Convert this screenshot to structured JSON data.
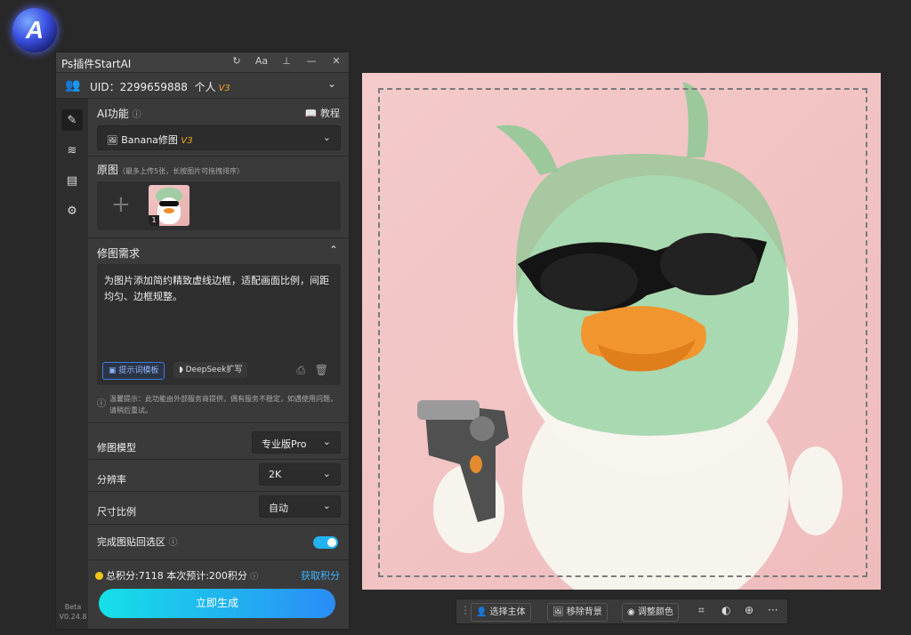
{
  "logo": {
    "letter": "A"
  },
  "panel": {
    "title": "Ps插件StartAI",
    "title_icons": [
      "refresh-icon",
      "font-size-icon",
      "pin-icon",
      "minimize-icon",
      "close-icon"
    ],
    "title_icon_glyphs": [
      "↻",
      "Aa",
      "⊥",
      "—",
      "✕"
    ],
    "uid_label": "UID：2299659888",
    "plan": "个人",
    "plan_version": "V3",
    "ai_function_label": "AI功能",
    "tutorial_label": "教程",
    "function_selected": "Banana修图",
    "function_version": "V3",
    "original_label": "原图",
    "original_note": "（最多上传5张，长按图片可拖拽排序）",
    "thumb_index": "1",
    "requirement_label": "修图需求",
    "requirement_text": "为图片添加简约精致虚线边框，适配画面比例，间距均匀、边框规整。",
    "prompt_template_label": "提示词模板",
    "deepseek_label": "DeepSeek扩写",
    "warning_text": "温馨提示：此功能由外部服务商提供，偶有服务不稳定，如遇使用问题，请稍后重试。",
    "model_label": "修图模型",
    "model_value": "专业版Pro",
    "resolution_label": "分辨率",
    "resolution_value": "2K",
    "ratio_label": "尺寸比例",
    "ratio_value": "自动",
    "paste_back_label": "完成图贴回选区",
    "paste_back_on": true,
    "points_text": "总积分:7118  本次预计:200积分",
    "get_points_label": "获取积分",
    "generate_label": "立即生成",
    "beta_label": "Beta",
    "version_label": "V0.24.8"
  },
  "toolbar": {
    "select_subject": "选择主体",
    "remove_bg": "移除背景",
    "adjust_color": "调整颜色",
    "more": "···"
  },
  "colors": {
    "accent": "#23b2ef",
    "warning_version": "#f5a623",
    "link": "#3fb6ff",
    "canvas_bg": "#f3c4c4"
  }
}
